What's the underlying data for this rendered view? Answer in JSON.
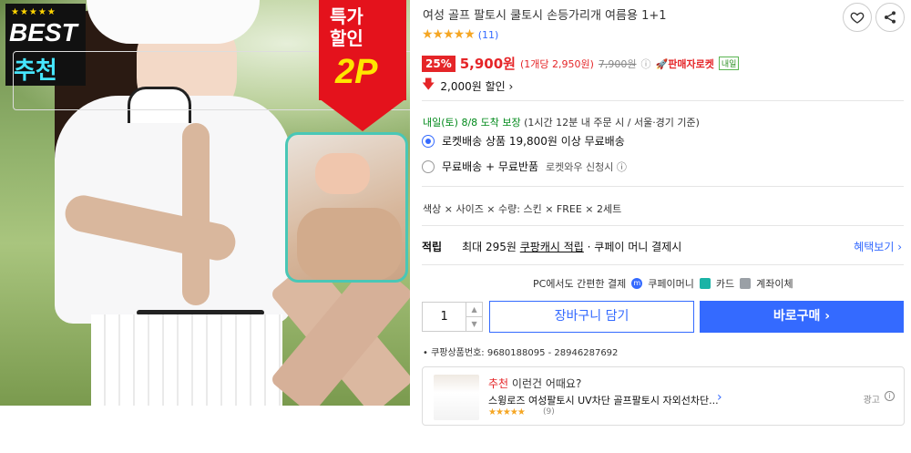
{
  "image": {
    "badge_stars": "★★★★★",
    "badge_best": "BEST",
    "badge_recommend": "추천",
    "sale_text": "특가\n할인",
    "sale_count": "2P"
  },
  "product": {
    "title": "여성 골프 팔토시 쿨토시 손등가리개 여름용 1+1",
    "stars": "★★★★★",
    "review_count": "(11)",
    "discount_pct": "25%",
    "price": "5,900원",
    "unit_price": "(1개당 2,950원)",
    "original_price": "7,900원",
    "seller_badge": "🚀판매자로켓",
    "tomorrow_badge": "내일",
    "coupon_discount": "2,000원 할인 ›"
  },
  "delivery": {
    "date_green": "내일(토) 8/8",
    "date_suffix": " 도착 보장",
    "date_note": " (1시간 12분 내 주문 시 / 서울·경기 기준)",
    "option1": "로켓배송 상품 19,800원 이상 무료배송",
    "option2": "무료배송 + 무료반품",
    "option2_note": "로켓와우 신청시 ⓘ"
  },
  "options": {
    "text": "색상 × 사이즈 × 수량: 스킨 × FREE × 2세트"
  },
  "mileage": {
    "label": "적립",
    "max": "최대 295원",
    "cash": "쿠팡캐시 적립",
    "rest": "· 쿠페이 머니 결제시",
    "more": "혜택보기 ›"
  },
  "payment": {
    "label": "PC에서도 간편한 결제",
    "coupay": "쿠페이머니",
    "card": "카드",
    "bank": "계좌이체"
  },
  "purchase": {
    "quantity": "1",
    "cart": "장바구니 담기",
    "buy": "바로구매 ›"
  },
  "codes": {
    "text": "쿠팡상품번호: 9680188095 - 28946287692"
  },
  "recommend": {
    "label_red": "추천",
    "label_rest": " 이런건 어때요?",
    "item_title": "스윙로즈 여성팔토시 UV차단 골프팔토시 자외선차단...",
    "stars": "★★★★★",
    "count": "(9)",
    "ad": "광고"
  },
  "colors": {
    "accent_blue": "#346aff",
    "sale_red": "#e52528",
    "green": "#00891a"
  }
}
